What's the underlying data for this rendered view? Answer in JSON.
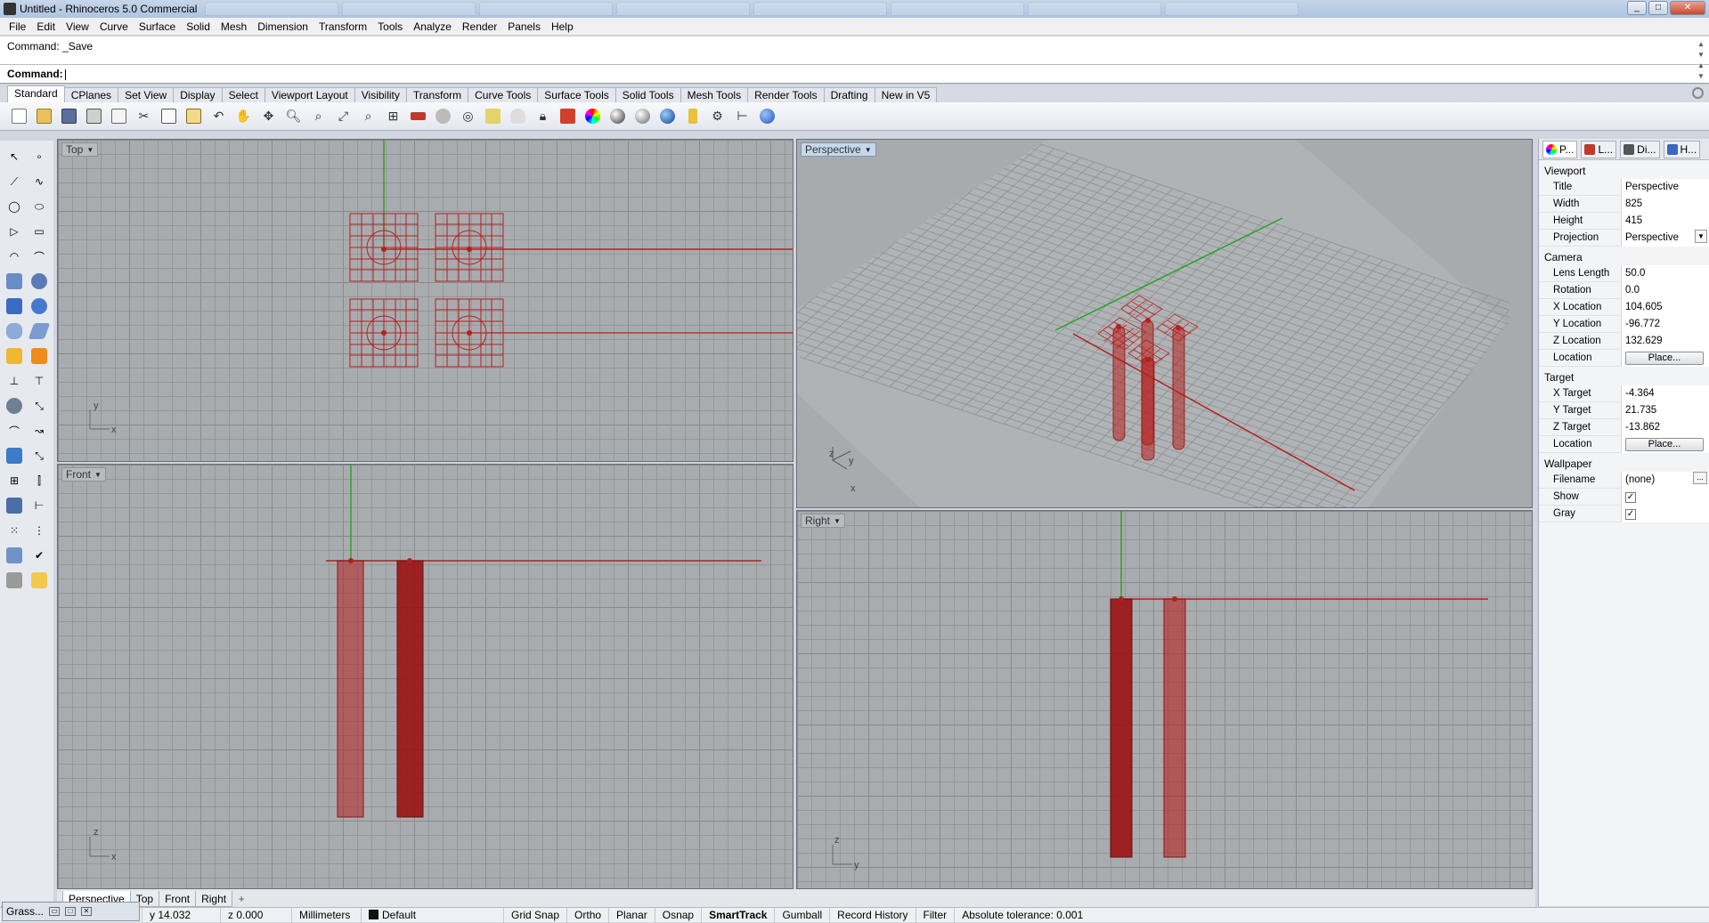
{
  "window": {
    "title": "Untitled - Rhinoceros 5.0 Commercial",
    "min": "_",
    "max": "□",
    "close": "✕"
  },
  "menu": [
    "File",
    "Edit",
    "View",
    "Curve",
    "Surface",
    "Solid",
    "Mesh",
    "Dimension",
    "Transform",
    "Tools",
    "Analyze",
    "Render",
    "Panels",
    "Help"
  ],
  "command": {
    "history": "Command: _Save",
    "prompt": "Command:"
  },
  "toolbar_tabs": [
    "Standard",
    "CPlanes",
    "Set View",
    "Display",
    "Select",
    "Viewport Layout",
    "Visibility",
    "Transform",
    "Curve Tools",
    "Surface Tools",
    "Solid Tools",
    "Mesh Tools",
    "Render Tools",
    "Drafting",
    "New in V5"
  ],
  "toolbar_icons": [
    "new-icon",
    "open-icon",
    "save-icon",
    "print-icon",
    "import-icon",
    "cut-icon",
    "copy-icon",
    "paste-icon",
    "undo-icon",
    "pan-icon",
    "rotate-view-icon",
    "zoom-icon",
    "zoom-window-icon",
    "zoom-extents-icon",
    "zoom-selected-icon",
    "four-viewports-icon",
    "car-icon",
    "sweep-icon",
    "circle-icon",
    "lights-icon",
    "bulb-icon",
    "lock-icon",
    "render-material-icon",
    "color-wheel-icon",
    "sphere-shade-icon",
    "sphere-render-icon",
    "sphere-blue-icon",
    "lasso-icon",
    "gear-options-icon",
    "dimension-icon",
    "help-icon"
  ],
  "colors": {
    "grid": "#8c8f92",
    "object": "#b4201e",
    "xaxis": "#b4201e",
    "yaxis": "#2ea12e",
    "viewport_bg": "#a9acaf"
  },
  "viewports": {
    "top": {
      "label": "Top",
      "axis_x": "x",
      "axis_y": "y"
    },
    "perspective": {
      "label": "Perspective",
      "axis_x": "x",
      "axis_y": "y",
      "axis_z": "z"
    },
    "front": {
      "label": "Front",
      "axis_x": "x",
      "axis_y": "z"
    },
    "right": {
      "label": "Right",
      "axis_x": "y",
      "axis_y": "z"
    }
  },
  "panel": {
    "tabs": [
      "P...",
      "L...",
      "Di...",
      "H..."
    ],
    "viewport_header": "Viewport",
    "title_label": "Title",
    "title_value": "Perspective",
    "width_label": "Width",
    "width_value": "825",
    "height_label": "Height",
    "height_value": "415",
    "projection_label": "Projection",
    "projection_value": "Perspective",
    "camera_header": "Camera",
    "lens_label": "Lens Length",
    "lens_value": "50.0",
    "rotation_label": "Rotation",
    "rotation_value": "0.0",
    "xloc_label": "X Location",
    "xloc_value": "104.605",
    "yloc_label": "Y Location",
    "yloc_value": "-96.772",
    "zloc_label": "Z Location",
    "zloc_value": "132.629",
    "location_label": "Location",
    "place_button": "Place...",
    "target_header": "Target",
    "xt_label": "X Target",
    "xt_value": "-4.364",
    "yt_label": "Y Target",
    "yt_value": "21.735",
    "zt_label": "Z Target",
    "zt_value": "-13.862",
    "tloc_label": "Location",
    "tplace_button": "Place...",
    "wallpaper_header": "Wallpaper",
    "filename_label": "Filename",
    "filename_value": "(none)",
    "filename_btn": "...",
    "show_label": "Show",
    "gray_label": "Gray",
    "check": "✓"
  },
  "viewport_tabs": [
    "Perspective",
    "Top",
    "Front",
    "Right",
    "+"
  ],
  "status": {
    "grasshopper": "Grass...",
    "y": "y 14.032",
    "z": "z 0.000",
    "units": "Millimeters",
    "layer": "Default",
    "grid_snap": "Grid Snap",
    "ortho": "Ortho",
    "planar": "Planar",
    "osnap": "Osnap",
    "smarttrack": "SmartTrack",
    "gumball": "Gumball",
    "record_history": "Record History",
    "filter": "Filter",
    "tolerance": "Absolute tolerance: 0.001"
  }
}
